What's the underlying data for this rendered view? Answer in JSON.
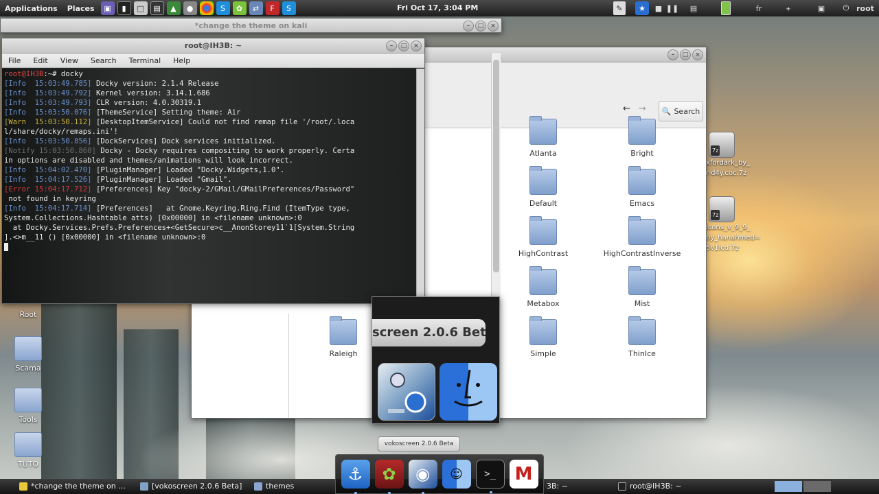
{
  "top_panel": {
    "applications_label": "Applications",
    "places_label": "Places",
    "clock": "Fri Oct 17,  3:04 PM",
    "keyboard_layout": "fr",
    "user": "root",
    "launchers": [
      "app-icon",
      "terminal-icon",
      "screenshot-icon",
      "monitor-icon",
      "chrome-icon",
      "gimp-icon",
      "chrome-icon",
      "skype-icon",
      "leaf-icon",
      "network-icon",
      "filezilla-icon",
      "skype-icon"
    ]
  },
  "editor_window": {
    "title": "*change the theme on kali"
  },
  "terminal": {
    "title": "root@IH3B: ~",
    "menu": [
      "File",
      "Edit",
      "View",
      "Search",
      "Terminal",
      "Help"
    ],
    "lines": [
      {
        "cls": "c-prompt",
        "prefix": "root@IH3B",
        "text": ":~# docky"
      },
      {
        "cls": "c-info",
        "prefix": "[Info  15:03:49.785]",
        "text": " Docky version: 2.1.4 Release"
      },
      {
        "cls": "c-info",
        "prefix": "[Info  15:03:49.792]",
        "text": " Kernel version: 3.14.1.686"
      },
      {
        "cls": "c-info",
        "prefix": "[Info  15:03:49.793]",
        "text": " CLR version: 4.0.30319.1"
      },
      {
        "cls": "c-info",
        "prefix": "[Info  15:03:50.076]",
        "text": " [ThemeService] Setting theme: Air"
      },
      {
        "cls": "c-warn",
        "prefix": "[Warn  15:03:50.112]",
        "text": " [DesktopItemService] Could not find remap file '/root/.loca"
      },
      {
        "cls": "",
        "prefix": "",
        "text": "l/share/docky/remaps.ini'!"
      },
      {
        "cls": "c-info",
        "prefix": "[Info  15:03:50.856]",
        "text": " [DockServices] Dock services initialized."
      },
      {
        "cls": "c-notify",
        "prefix": "[Notify 15:03:50.860]",
        "text": " Docky - Docky requires compositing to work properly. Certa"
      },
      {
        "cls": "",
        "prefix": "",
        "text": "in options are disabled and themes/animations will look incorrect."
      },
      {
        "cls": "c-info",
        "prefix": "[Info  15:04:02.470]",
        "text": " [PluginManager] Loaded \"Docky.Widgets,1.0\"."
      },
      {
        "cls": "c-info",
        "prefix": "[Info  15:04:17.526]",
        "text": " [PluginManager] Loaded \"Gmail\"."
      },
      {
        "cls": "c-error",
        "prefix": "[Error 15:04:17.712]",
        "text": " [Preferences] Key \"docky-2/GMail/GMailPreferences/Password\""
      },
      {
        "cls": "",
        "prefix": "",
        "text": " not found in keyring"
      },
      {
        "cls": "c-info",
        "prefix": "[Info  15:04:17.714]",
        "text": " [Preferences]   at Gnome.Keyring.Ring.Find (ItemType type,"
      },
      {
        "cls": "",
        "prefix": "",
        "text": "System.Collections.Hashtable atts) [0x00000] in <filename unknown>:0"
      },
      {
        "cls": "",
        "prefix": "",
        "text": "  at Docky.Services.Prefs.Preferences+<GetSecure>c__AnonStorey11`1[System.String"
      },
      {
        "cls": "",
        "prefix": "",
        "text": "].<>m__11 () [0x00000] in <filename unknown>:0"
      }
    ]
  },
  "file_manager": {
    "search_label": "Search",
    "folders": [
      "Atlanta",
      "Bright",
      "Default",
      "Emacs",
      "HighContrast",
      "HighContrastInverse",
      "Metabox",
      "Mist",
      "Simple",
      "ThinIce",
      "Raleigh"
    ]
  },
  "popup": {
    "label": "screen 2.0.6 Beta",
    "tooltip": "vokoscreen 2.0.6 Beta"
  },
  "desktop": {
    "icons": [
      "Root",
      "Scama",
      "Tools",
      "TUTO"
    ],
    "zips": [
      {
        "line1": "xfordark_by_",
        "line2": "r-d4y.coc.7z"
      },
      {
        "line1": "icons_v_9_9_",
        "line2": "by_hanahmed=",
        "line3": "5v1icd.7z"
      }
    ],
    "zip_badge": "7z"
  },
  "taskbar": {
    "tasks": [
      "*change the theme on ...",
      "[vokoscreen 2.0.6 Beta]",
      "themes",
      "root@IH3B: ~"
    ],
    "partial_task": "3B: ~"
  },
  "dock": {
    "icons": [
      "anchor-icon",
      "leaf-icon",
      "vokoscreen-icon",
      "finder-icon",
      "terminal-icon",
      "gmail-icon"
    ]
  },
  "colors": {
    "prompt": "#e34646",
    "info": "#6a8fc7",
    "warn": "#c7b23c",
    "error": "#d23a3a",
    "folder": "#8aa5cf"
  }
}
